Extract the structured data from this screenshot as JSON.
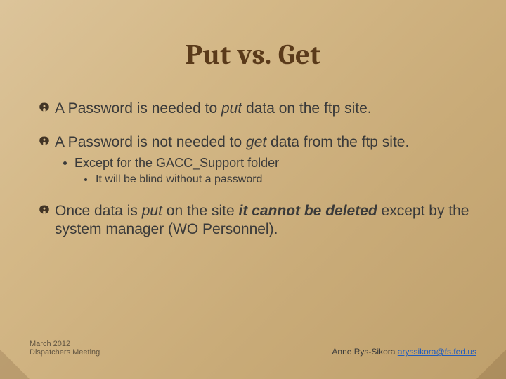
{
  "title": "Put vs. Get",
  "bullets": [
    {
      "pre": "A Password is needed to ",
      "em": "put",
      "post": " data on the ftp site."
    },
    {
      "pre": "A Password is not needed to ",
      "em": "get",
      "post": " data from the ftp site.",
      "sub": [
        {
          "text": "Except for the GACC_Support  folder",
          "sub": [
            {
              "text": "It will be blind without a password"
            }
          ]
        }
      ]
    },
    {
      "pre": "Once data is ",
      "em": "put",
      "mid": " on the site ",
      "strong": "it cannot be deleted",
      "post": " except by the system manager (WO Personnel)."
    }
  ],
  "footer": {
    "left_line1": "March 2012",
    "left_line2": "Dispatchers Meeting",
    "author": "Anne Rys-Sikora ",
    "email": "aryssikora@fs.fed.us"
  }
}
